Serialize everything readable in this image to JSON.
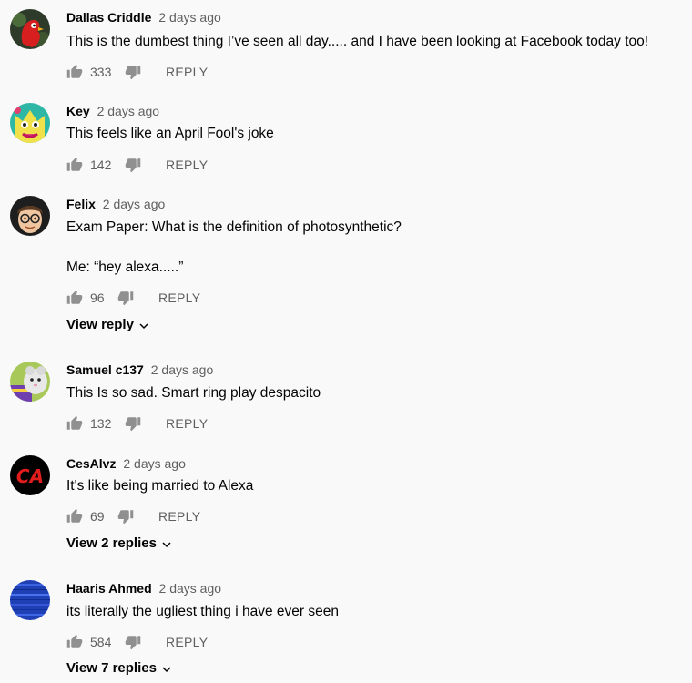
{
  "comments": [
    {
      "author": "Dallas Criddle",
      "time": "2 days ago",
      "text": [
        "This is the dumbest thing I’ve seen all day..... and I have been looking at Facebook today too!"
      ],
      "likes": "333",
      "reply_label": "REPLY",
      "avatar_icon": "red-bird-avatar"
    },
    {
      "author": "Key",
      "time": "2 days ago",
      "text": [
        "This feels like an April Fool's joke"
      ],
      "likes": "142",
      "reply_label": "REPLY",
      "avatar_icon": "cartoon-cat-avatar"
    },
    {
      "author": "Felix",
      "time": "2 days ago",
      "text": [
        "Exam Paper: What is the definition of photosynthetic?",
        "Me: “hey alexa.....”"
      ],
      "likes": "96",
      "reply_label": "REPLY",
      "view_replies": "View reply",
      "avatar_icon": "memoji-glasses-avatar"
    },
    {
      "author": "Samuel c137",
      "time": "2 days ago",
      "text": [
        "This Is so sad. Smart ring play despacito"
      ],
      "likes": "132",
      "reply_label": "REPLY",
      "avatar_icon": "hamster-avatar"
    },
    {
      "author": "CesAlvz",
      "time": "2 days ago",
      "text": [
        "It's like being married to Alexa"
      ],
      "likes": "69",
      "reply_label": "REPLY",
      "view_replies": "View 2 replies",
      "avatar_icon": "ca-logo-avatar",
      "avatar_text": "CA"
    },
    {
      "author": "Haaris Ahmed",
      "time": "2 days ago",
      "text": [
        "its literally the ugliest thing i have ever seen"
      ],
      "likes": "584",
      "reply_label": "REPLY",
      "view_replies": "View 7 replies",
      "avatar_icon": "blue-noise-avatar"
    }
  ],
  "colors": {
    "background": "#f9f9f9",
    "text": "#030303",
    "secondary": "#606060"
  }
}
